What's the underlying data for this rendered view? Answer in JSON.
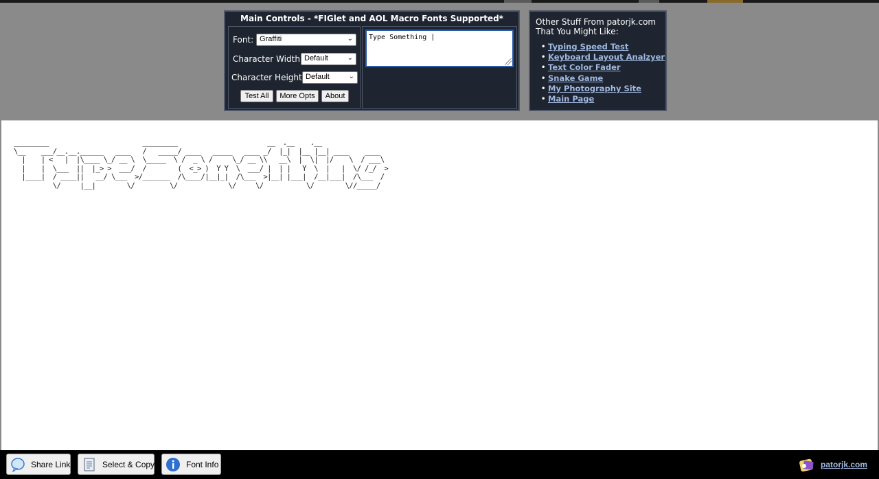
{
  "main_controls": {
    "title": "Main Controls - *FIGlet and AOL Macro Fonts Supported*",
    "font_label": "Font:",
    "font_value": "Graffiti",
    "char_width_label": "Character Width:",
    "char_width_value": "Default",
    "char_height_label": "Character Height:",
    "char_height_value": "Default",
    "buttons": {
      "test_all": "Test All",
      "more_opts": "More Opts",
      "about": "About"
    },
    "input_text": "Type Something |"
  },
  "other_stuff": {
    "intro_line1": "Other Stuff From patorjk.com",
    "intro_line2": "That You Might Like:",
    "links": [
      "Typing Speed Test",
      "Keyboard Layout Analzyer",
      "Text Color Fader",
      "Snake Game",
      "My Photography Site",
      "Main Page"
    ]
  },
  "output_ascii": "_________                        _________                       __  .__    .__\n\\__    ___/__.__.______   ____   /   _____/ ____   _____   ____ _/  |_|  |__ |__| ____    ____\n  |    | <   |  |\\____ \\_/ __ \\  \\_____  \\ /  _ \\ /     \\_/ __ \\\\   __\\  |  \\|  |/    \\  / ___\\\n  |    |  \\___  ||  |_> >  ___/  /        (  <_> )  Y Y  \\  ___/ |  | |   Y  \\  |   |  \\/ /_/  >\n  |____|  / ____||   __/ \\___  >/_______  /\\____/|__|_|  /\\___  >|__| |___|  /__|___|  /\\___  /\n          \\/     |__|        \\/         \\/             \\/     \\/           \\/        \\//_____/",
  "bottom_bar": {
    "share_link": "Share Link",
    "select_copy": "Select & Copy",
    "font_info": "Font Info",
    "brand": "patorjk.com"
  },
  "colors": {
    "panel_bg": "#1e2430",
    "panel_border": "#4f5868",
    "page_bg": "#8a8a8a",
    "link": "#9fb8e0",
    "bottom_bar": "#000000"
  }
}
